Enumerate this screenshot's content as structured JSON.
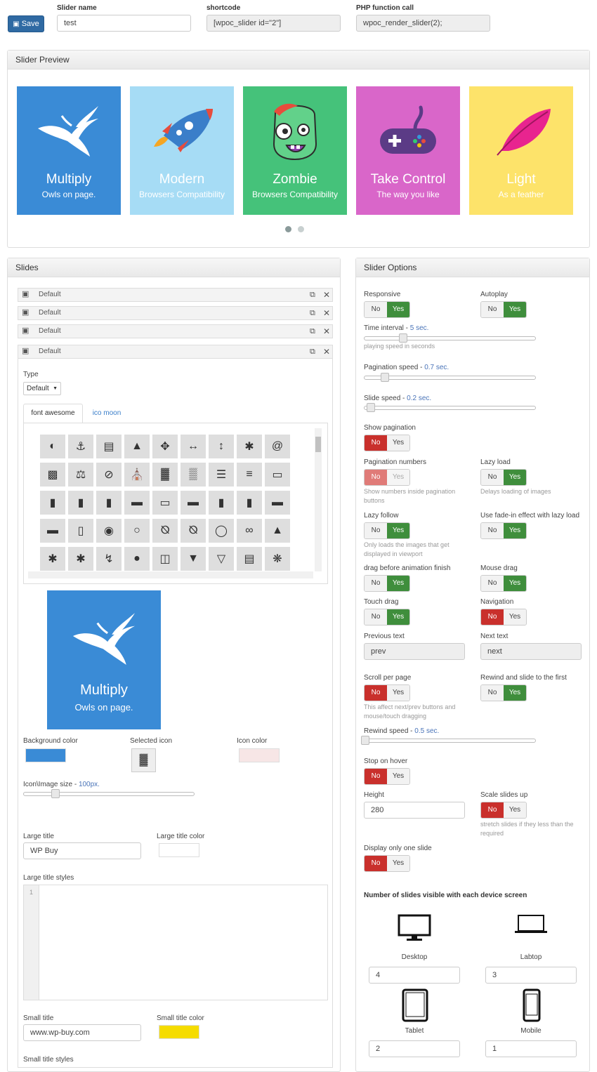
{
  "header": {
    "save_label": "Save",
    "slider_name_label": "Slider name",
    "slider_name_value": "test",
    "shortcode_label": "shortcode",
    "shortcode_value": "[wpoc_slider id=\"2\"]",
    "php_label": "PHP function call",
    "php_value": "wpoc_render_slider(2);"
  },
  "preview": {
    "title": "Slider Preview",
    "cards": [
      {
        "title": "Multiply",
        "subtitle": "Owls on page.",
        "bg": "#3a8bd6",
        "icon": "bird-icon"
      },
      {
        "title": "Modern",
        "subtitle": "Browsers Compatibility",
        "bg": "#a6dcf5",
        "icon": "rocket-icon"
      },
      {
        "title": "Zombie",
        "subtitle": "Browsers Compatibility",
        "bg": "#45c27a",
        "icon": "zombie-icon"
      },
      {
        "title": "Take Control",
        "subtitle": "The way you like",
        "bg": "#d966c9",
        "icon": "gamepad-icon"
      },
      {
        "title": "Light",
        "subtitle": "As a feather",
        "bg": "#fde36a",
        "icon": "feather-icon"
      }
    ]
  },
  "slides": {
    "title": "Slides",
    "items": [
      "Default",
      "Default",
      "Default",
      "Default"
    ],
    "type_label": "Type",
    "type_value": "Default",
    "tab_fa": "font awesome",
    "tab_im": "ico moon",
    "preview_title": "Multiply",
    "preview_subtitle": "Owls on page.",
    "bg_color_label": "Background color",
    "bg_color": "#3a8bd6",
    "selected_icon_label": "Selected icon",
    "icon_color_label": "Icon color",
    "icon_color": "#f7e6e6",
    "icon_size_label": "Icon\\Image size",
    "icon_size_value": "100px.",
    "large_title_label": "Large title",
    "large_title_value": "WP Buy",
    "large_title_color_label": "Large title color",
    "large_title_styles_label": "Large title styles",
    "line_no": "1",
    "small_title_label": "Small title",
    "small_title_value": "www.wp-buy.com",
    "small_title_color_label": "Small title color",
    "small_title_color": "#f5dc00",
    "small_title_styles_label": "Small title styles"
  },
  "options": {
    "title": "Slider Options",
    "no": "No",
    "yes": "Yes",
    "responsive": "Responsive",
    "autoplay": "Autoplay",
    "time_interval": "Time interval",
    "time_interval_value": "5 sec.",
    "time_interval_hint": "playing speed in seconds",
    "time_interval_level": 0.23,
    "pagination_speed": "Pagination speed",
    "pagination_speed_value": "0.7 sec.",
    "pagination_speed_level": 0.12,
    "slide_speed": "Slide speed",
    "slide_speed_value": "0.2 sec.",
    "slide_speed_level": 0.03,
    "show_pagination": "Show pagination",
    "pagination_numbers": "Pagination numbers",
    "pagination_numbers_hint": "Show numbers inside pagination buttons",
    "lazy_load": "Lazy load",
    "lazy_load_hint": "Delays loading of images",
    "lazy_follow": "Lazy follow",
    "lazy_follow_hint": "Only loads the images that get displayed in viewport",
    "fade_in": "Use fade-in effect with lazy load",
    "drag_before": "drag before animation finish",
    "mouse_drag": "Mouse drag",
    "touch_drag": "Touch drag",
    "navigation": "Navigation",
    "previous_text": "Previous text",
    "previous_value": "prev",
    "next_text": "Next text",
    "next_value": "next",
    "scroll_per_page": "Scroll per page",
    "scroll_hint": "This affect next/prev buttons and mouse/touch dragging",
    "rewind_slide": "Rewind and slide to the first",
    "rewind_speed": "Rewind speed",
    "rewind_speed_value": "0.5 sec.",
    "rewind_speed_level": 0.0,
    "stop_on_hover": "Stop on hover",
    "height": "Height",
    "height_value": "280",
    "scale_up": "Scale slides up",
    "scale_hint": "stretch slides if they less than the required",
    "one_slide": "Display only one slide",
    "devices_title": "Number of slides visible with each device screen",
    "desktop": "Desktop",
    "desktop_value": "4",
    "laptop": "Labtop",
    "laptop_value": "3",
    "tablet": "Tablet",
    "tablet_value": "2",
    "mobile": "Mobile",
    "mobile_value": "1"
  }
}
